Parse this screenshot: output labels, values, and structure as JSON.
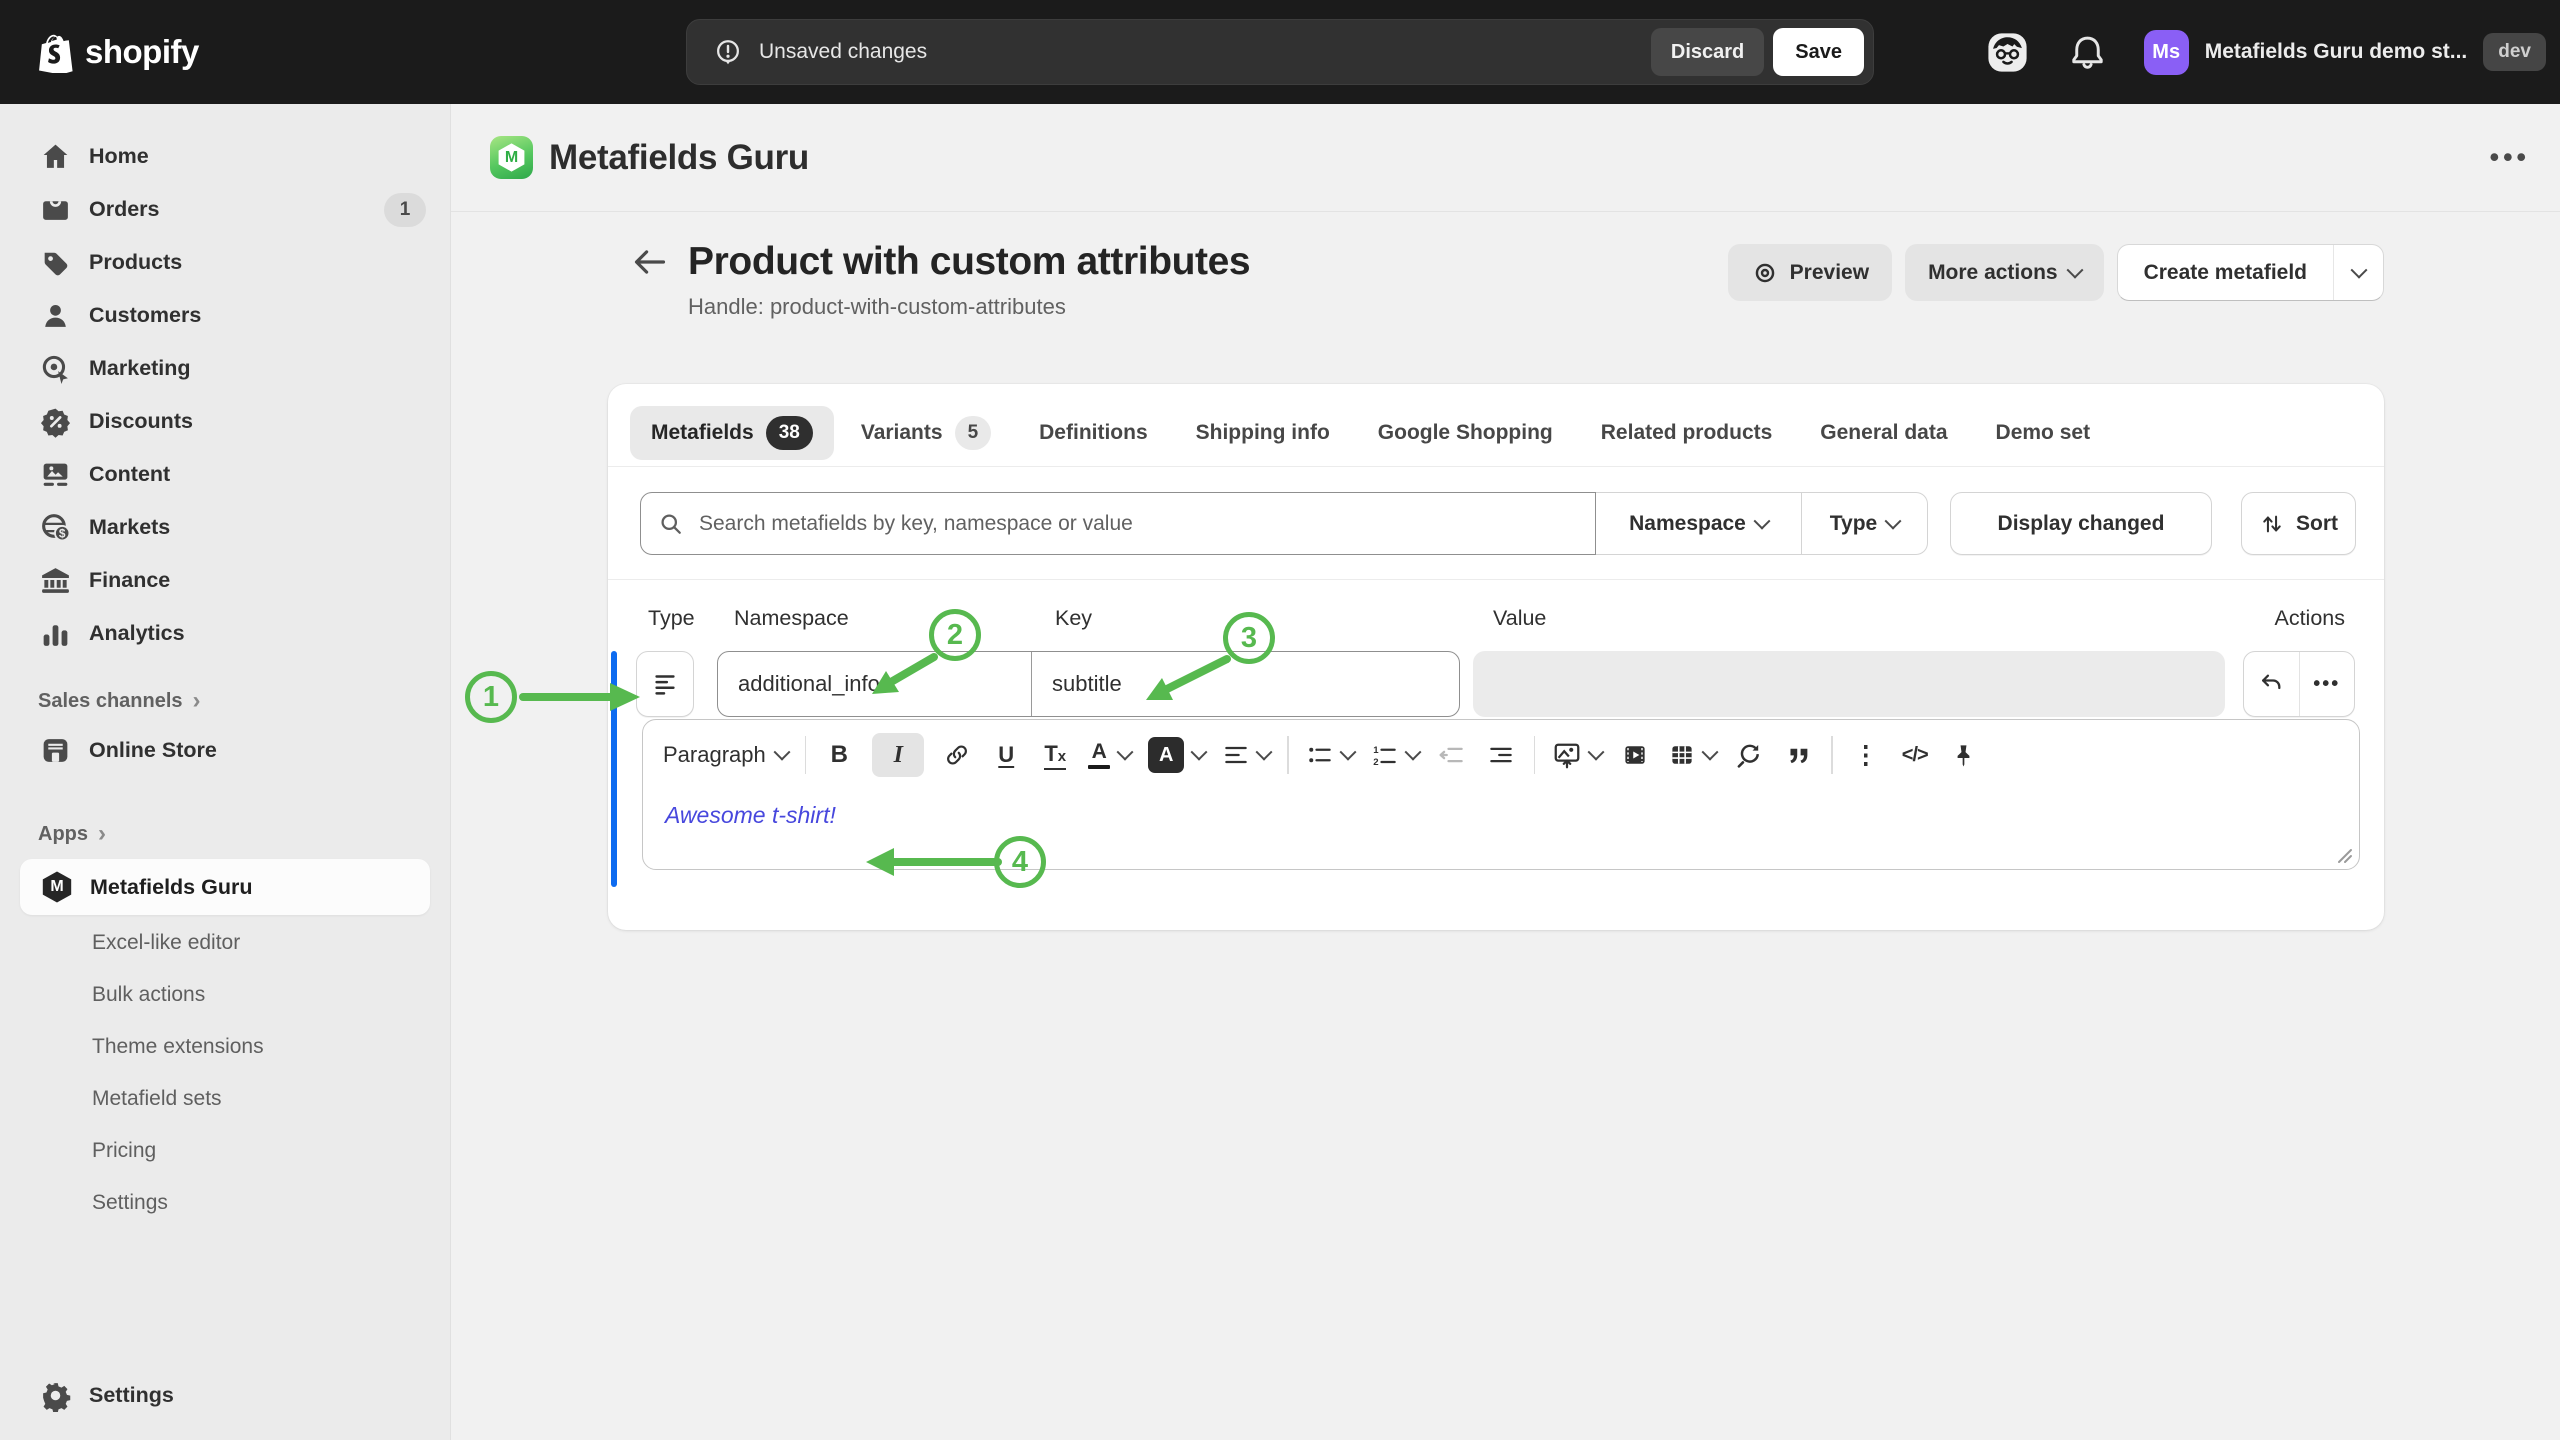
{
  "topbar": {
    "logo": "shopify",
    "status": {
      "message": "Unsaved changes",
      "discard": "Discard",
      "save": "Save"
    },
    "account": {
      "initials": "Ms",
      "store": "Metafields Guru demo st...",
      "env": "dev",
      "avatar_color": "#8a5ff5"
    }
  },
  "sidebar": {
    "items": [
      {
        "label": "Home"
      },
      {
        "label": "Orders",
        "badge": "1"
      },
      {
        "label": "Products"
      },
      {
        "label": "Customers"
      },
      {
        "label": "Marketing"
      },
      {
        "label": "Discounts"
      },
      {
        "label": "Content"
      },
      {
        "label": "Markets"
      },
      {
        "label": "Finance"
      },
      {
        "label": "Analytics"
      }
    ],
    "sales_channels": {
      "label": "Sales channels",
      "items": [
        {
          "label": "Online Store"
        }
      ]
    },
    "apps": {
      "label": "Apps",
      "active": "Metafields Guru",
      "items": [
        {
          "label": "Excel-like editor"
        },
        {
          "label": "Bulk actions"
        },
        {
          "label": "Theme extensions"
        },
        {
          "label": "Metafield sets"
        },
        {
          "label": "Pricing"
        },
        {
          "label": "Settings"
        }
      ]
    },
    "settings": "Settings"
  },
  "app_header": {
    "title": "Metafields Guru"
  },
  "page": {
    "title": "Product with custom attributes",
    "handle": "Handle: product-with-custom-attributes",
    "actions": {
      "preview": "Preview",
      "more": "More actions",
      "create": "Create metafield"
    }
  },
  "tabs": [
    {
      "label": "Metafields",
      "badge": "38"
    },
    {
      "label": "Variants",
      "badge": "5"
    },
    {
      "label": "Definitions"
    },
    {
      "label": "Shipping info"
    },
    {
      "label": "Google Shopping"
    },
    {
      "label": "Related products"
    },
    {
      "label": "General data"
    },
    {
      "label": "Demo set"
    }
  ],
  "filters": {
    "search_placeholder": "Search metafields by key, namespace or value",
    "namespace": "Namespace",
    "type": "Type",
    "display_changed": "Display changed",
    "sort": "Sort"
  },
  "table": {
    "headers": {
      "type": "Type",
      "namespace": "Namespace",
      "key": "Key",
      "value": "Value",
      "actions": "Actions"
    },
    "row": {
      "namespace": "additional_info",
      "key": "subtitle",
      "value": ""
    }
  },
  "editor": {
    "block_format": "Paragraph",
    "content": "Awesome t-shirt!",
    "text_color": "#4747dd"
  },
  "annotations": {
    "color": "#57b94f",
    "labels": [
      "1",
      "2",
      "3",
      "4"
    ]
  },
  "colors": {
    "changed_bar": "#0d6bf0",
    "topbar_bg": "#1b1b1b",
    "sidebar_bg": "#ebebeb",
    "app_icon_green": "#2ea84a"
  }
}
